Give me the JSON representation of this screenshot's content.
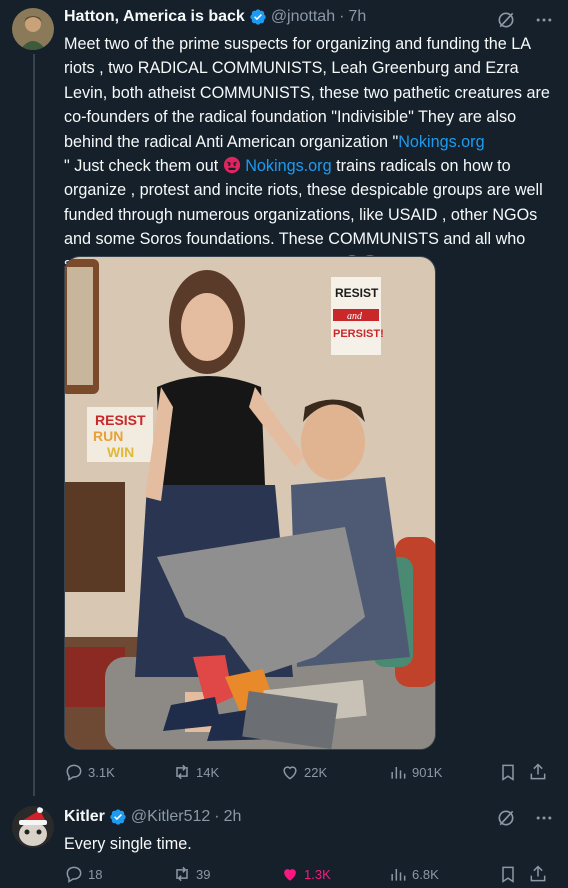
{
  "tweet1": {
    "author_name": "Hatton, America is back",
    "handle": "@jnottah",
    "time": "7h",
    "text_before_link1": "Meet two of the prime suspects for organizing and funding the LA riots , two RADICAL COMMUNISTS,  Leah Greenburg and Ezra Levin,  both atheist COMMUNISTS, these two pathetic creatures are co-founders of the radical foundation \"Indivisible\" They are also behind the radical Anti American organization \"",
    "link1": "Nokings.org",
    "text_after_link1": "\"  Just check them out ",
    "link2": "Nokings.org",
    "text_after_link2": "  trains radicals on how to organize , protest and incite riots, these despicable groups are well funded through numerous organizations,  like USAID , other NGOs and some Soros foundations. These COMMUNISTS and all who sponsors them, need to be EXPOSED ",
    "media": {
      "sign_top_right": [
        "RESIST",
        "and",
        "PERSIST!"
      ],
      "sign_left": [
        "RESIST",
        "RUN",
        "WIN"
      ]
    },
    "stats": {
      "replies": "3.1K",
      "reposts": "14K",
      "likes": "22K",
      "views": "901K"
    }
  },
  "tweet2": {
    "author_name": "Kitler",
    "handle": "@Kitler512",
    "time": "2h",
    "text": "Every single time.",
    "stats": {
      "replies": "18",
      "reposts": "39",
      "likes": "1.3K",
      "views": "6.8K"
    }
  },
  "colors": {
    "background": "#15202b",
    "link": "#1d9bf0",
    "muted": "#8b98a5",
    "like_active": "#f91880"
  },
  "icons": [
    "verified-badge-icon",
    "grok-icon",
    "more-icon",
    "reply-icon",
    "repost-icon",
    "like-icon",
    "views-icon",
    "bookmark-icon",
    "share-icon",
    "angry-face-icon"
  ]
}
